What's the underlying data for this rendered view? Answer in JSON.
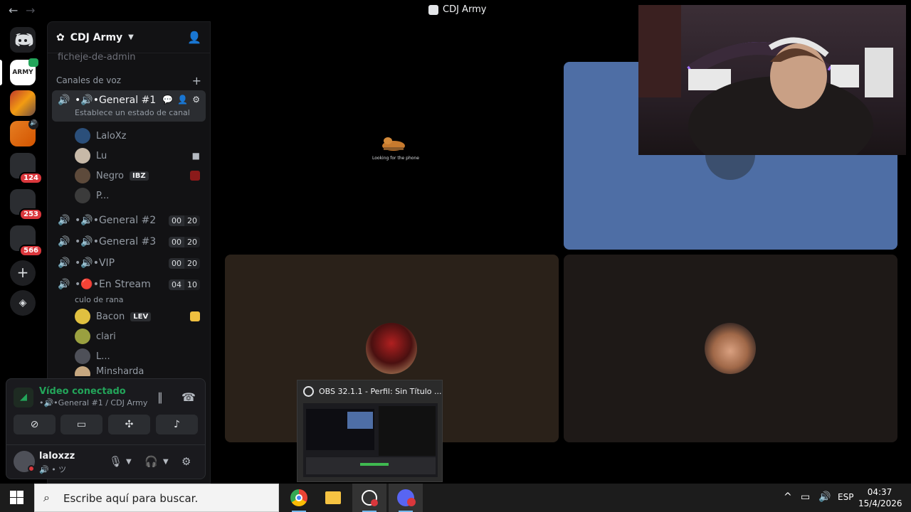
{
  "titlebar": {
    "back": "←",
    "forward": "→",
    "title": "CDJ Army"
  },
  "rail": {
    "badges": [
      "124",
      "253",
      "566"
    ]
  },
  "server": {
    "name": "CDJ Army",
    "truncated_channel": "ficheje-de-admin",
    "category": "Canales de voz",
    "channels": [
      {
        "name": "•🔊•General #1",
        "status": "Establece un estado de canal",
        "users": [
          {
            "name": "LaloXz"
          },
          {
            "name": "Lu"
          },
          {
            "name": "Negro",
            "tag": "IBZ"
          },
          {
            "name": "P..."
          }
        ]
      },
      {
        "name": "•🔊•General #2",
        "count_a": "00",
        "count_b": "20"
      },
      {
        "name": "•🔊•General #3",
        "count_a": "00",
        "count_b": "20"
      },
      {
        "name": "•🔊•VIP",
        "count_a": "00",
        "count_b": "20"
      },
      {
        "name": "•🔴•En Stream",
        "count_a": "04",
        "count_b": "10",
        "status": "culo de rana",
        "users": [
          {
            "name": "Bacon",
            "tag": "LEV"
          },
          {
            "name": "clari"
          },
          {
            "name": "L..."
          },
          {
            "name": "Minsharda"
          }
        ]
      }
    ]
  },
  "voice_panel": {
    "status": "Vídeo conectado",
    "location": "•🔊•General #1 / CDJ Army",
    "user": {
      "name": "laloxzz",
      "status": "🔊 • ツ"
    }
  },
  "main": {
    "tile1_caption": "Looking for the phone"
  },
  "obs": {
    "title": "OBS 32.1.1 - Perfil: Sin Título ..."
  },
  "taskbar": {
    "search_placeholder": "Escribe aquí para buscar.",
    "language": "ESP",
    "time": "04:37",
    "date": "15/4/2026"
  }
}
